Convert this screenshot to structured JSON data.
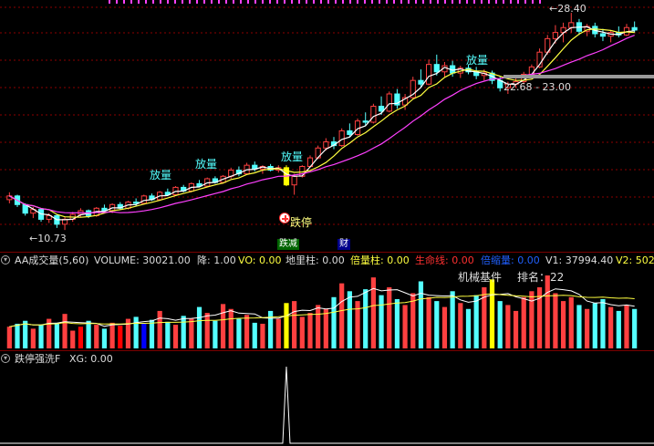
{
  "colors": {
    "background": "#000000",
    "grid": "#8b0000",
    "up": "#ff4040",
    "down": "#54ffff",
    "ma_short": "#ffffff",
    "ma_mid": "#ffff40",
    "ma_long": "#ff40ff",
    "volume_mark": "#ffff00",
    "volume_blue": "#0000ff",
    "volume_red": "#ff0000"
  },
  "price_panel": {
    "high_label": "28.40",
    "low_label": "10.73",
    "low_arrow": "←",
    "high_arrow": "←",
    "range_label": "22.68 - 23.00",
    "annotations": [
      "放量",
      "放量",
      "放量",
      "放量",
      "跌停"
    ],
    "tags": [
      {
        "text": "跌减",
        "bg": "#006400",
        "fg": "#ffffff"
      },
      {
        "text": "财",
        "bg": "#00008b",
        "fg": "#ffffff"
      }
    ]
  },
  "volume_panel": {
    "title": "AA成交量(5,60)",
    "items": [
      {
        "name": "VOLUME",
        "text": "VOLUME: 30021.00",
        "color": "#dddddd"
      },
      {
        "name": "jiang",
        "text": "降: 1.00",
        "color": "#dddddd"
      },
      {
        "name": "vo",
        "text": "VO: 0.00",
        "color": "#ffff40"
      },
      {
        "name": "diliang",
        "text": "地里柱: 0.00",
        "color": "#dddddd"
      },
      {
        "name": "beiliang",
        "text": "倍量柱: 0.00",
        "color": "#ffff40"
      },
      {
        "name": "shengming",
        "text": "生命线: 0.00",
        "color": "#ff3030"
      },
      {
        "name": "beisuo",
        "text": "倍缩量: 0.00",
        "color": "#2060ff"
      },
      {
        "name": "v1",
        "text": "V1: 37994.40",
        "color": "#dddddd"
      },
      {
        "name": "v2",
        "text": "V2: 502",
        "color": "#ffff40"
      }
    ],
    "sector_label": "机械基件",
    "rank_label": "排名：22"
  },
  "signal_panel": {
    "title": "跌停强洗F",
    "xg_text": "XG: 0.00"
  },
  "chart_data": {
    "type": "candlestick",
    "candles": [
      [
        13.2,
        13.8,
        12.9,
        13.5
      ],
      [
        13.5,
        13.6,
        12.6,
        12.8
      ],
      [
        12.8,
        12.9,
        11.9,
        12.1
      ],
      [
        12.1,
        12.6,
        11.7,
        12.4
      ],
      [
        12.4,
        12.5,
        11.4,
        11.6
      ],
      [
        11.6,
        12.1,
        11.3,
        11.9
      ],
      [
        11.9,
        12.0,
        10.9,
        11.2
      ],
      [
        11.2,
        11.8,
        10.73,
        11.6
      ],
      [
        11.6,
        12.2,
        11.4,
        12.0
      ],
      [
        12.0,
        12.5,
        11.8,
        12.3
      ],
      [
        12.3,
        12.4,
        11.7,
        11.9
      ],
      [
        11.9,
        12.6,
        11.8,
        12.5
      ],
      [
        12.5,
        12.8,
        12.2,
        12.3
      ],
      [
        12.3,
        12.9,
        12.1,
        12.8
      ],
      [
        12.8,
        13.0,
        12.4,
        12.5
      ],
      [
        12.5,
        13.1,
        12.4,
        13.0
      ],
      [
        13.0,
        13.3,
        12.7,
        12.9
      ],
      [
        12.9,
        13.6,
        12.8,
        13.5
      ],
      [
        13.5,
        13.7,
        13.1,
        13.2
      ],
      [
        13.2,
        13.9,
        13.1,
        13.8
      ],
      [
        13.8,
        14.1,
        13.5,
        13.6
      ],
      [
        13.6,
        14.3,
        13.5,
        14.2
      ],
      [
        14.2,
        14.4,
        13.8,
        13.9
      ],
      [
        13.9,
        14.6,
        13.8,
        14.5
      ],
      [
        14.5,
        14.8,
        14.2,
        14.3
      ],
      [
        14.3,
        15.0,
        14.2,
        14.9
      ],
      [
        14.9,
        15.1,
        14.5,
        14.6
      ],
      [
        14.6,
        15.2,
        14.5,
        15.1
      ],
      [
        15.1,
        15.8,
        14.9,
        15.6
      ],
      [
        15.6,
        15.9,
        15.1,
        15.3
      ],
      [
        15.3,
        16.2,
        15.2,
        16.0
      ],
      [
        16.0,
        16.3,
        15.5,
        15.7
      ],
      [
        15.7,
        16.0,
        15.3,
        15.9
      ],
      [
        15.9,
        16.1,
        15.5,
        15.6
      ],
      [
        15.6,
        16.0,
        15.4,
        15.8
      ],
      [
        15.8,
        16.0,
        14.3,
        14.4
      ],
      [
        14.4,
        15.3,
        13.6,
        15.1
      ],
      [
        15.1,
        16.0,
        15.0,
        15.9
      ],
      [
        15.9,
        16.8,
        15.8,
        16.6
      ],
      [
        16.6,
        17.6,
        16.5,
        17.4
      ],
      [
        17.4,
        18.2,
        17.2,
        17.9
      ],
      [
        17.9,
        18.3,
        17.3,
        17.6
      ],
      [
        17.6,
        19.0,
        17.5,
        18.8
      ],
      [
        18.8,
        19.4,
        18.3,
        18.5
      ],
      [
        18.5,
        19.8,
        18.4,
        19.6
      ],
      [
        19.6,
        20.3,
        19.2,
        19.5
      ],
      [
        19.5,
        21.0,
        19.4,
        20.8
      ],
      [
        20.8,
        21.6,
        20.1,
        20.4
      ],
      [
        20.4,
        22.0,
        20.3,
        21.8
      ],
      [
        21.8,
        22.2,
        20.6,
        20.9
      ],
      [
        20.9,
        21.8,
        20.5,
        21.5
      ],
      [
        21.5,
        23.2,
        21.4,
        22.9
      ],
      [
        22.9,
        23.8,
        22.3,
        22.6
      ],
      [
        22.6,
        24.6,
        22.5,
        24.2
      ],
      [
        24.2,
        25.0,
        23.3,
        23.6
      ],
      [
        23.6,
        24.4,
        23.2,
        24.1
      ],
      [
        24.1,
        24.5,
        23.2,
        23.5
      ],
      [
        23.5,
        24.1,
        23.1,
        23.9
      ],
      [
        23.9,
        24.2,
        23.4,
        23.6
      ],
      [
        23.6,
        24.0,
        23.0,
        23.3
      ],
      [
        23.3,
        23.8,
        22.9,
        23.5
      ],
      [
        23.5,
        23.7,
        22.6,
        22.9
      ],
      [
        22.9,
        23.2,
        22.0,
        22.3
      ],
      [
        22.3,
        22.8,
        21.8,
        22.6
      ],
      [
        22.6,
        23.1,
        22.3,
        22.8
      ],
      [
        22.8,
        23.6,
        22.6,
        23.4
      ],
      [
        23.4,
        24.2,
        23.2,
        24.0
      ],
      [
        24.0,
        25.5,
        23.9,
        25.2
      ],
      [
        25.2,
        26.6,
        25.0,
        26.3
      ],
      [
        26.3,
        27.4,
        25.9,
        26.8
      ],
      [
        26.8,
        27.6,
        26.0,
        27.2
      ],
      [
        27.2,
        28.4,
        26.8,
        27.6
      ],
      [
        27.6,
        27.9,
        26.6,
        26.9
      ],
      [
        26.9,
        27.5,
        26.5,
        27.3
      ],
      [
        27.3,
        27.6,
        26.4,
        26.7
      ],
      [
        26.7,
        27.1,
        26.1,
        26.5
      ],
      [
        26.5,
        27.0,
        26.0,
        26.8
      ],
      [
        26.8,
        27.3,
        26.4,
        26.6
      ],
      [
        26.6,
        27.5,
        26.5,
        27.2
      ],
      [
        27.2,
        27.7,
        26.8,
        27.0
      ]
    ],
    "volume": [
      22,
      25,
      28,
      20,
      24,
      30,
      26,
      35,
      18,
      22,
      28,
      24,
      20,
      26,
      23,
      30,
      32,
      25,
      29,
      38,
      27,
      24,
      33,
      30,
      42,
      36,
      28,
      45,
      40,
      30,
      34,
      26,
      25,
      38,
      30,
      46,
      48,
      32,
      36,
      44,
      40,
      52,
      66,
      58,
      48,
      60,
      72,
      54,
      62,
      50,
      44,
      56,
      68,
      52,
      48,
      42,
      58,
      46,
      40,
      54,
      62,
      70,
      48,
      44,
      38,
      52,
      58,
      62,
      74,
      56,
      48,
      52,
      44,
      40,
      46,
      50,
      42,
      38,
      44,
      40
    ],
    "volume_highlights": {
      "red": [
        9,
        14
      ],
      "blue": [
        17
      ],
      "yellow": [
        35,
        61
      ]
    },
    "signal_spike_index": 35
  }
}
